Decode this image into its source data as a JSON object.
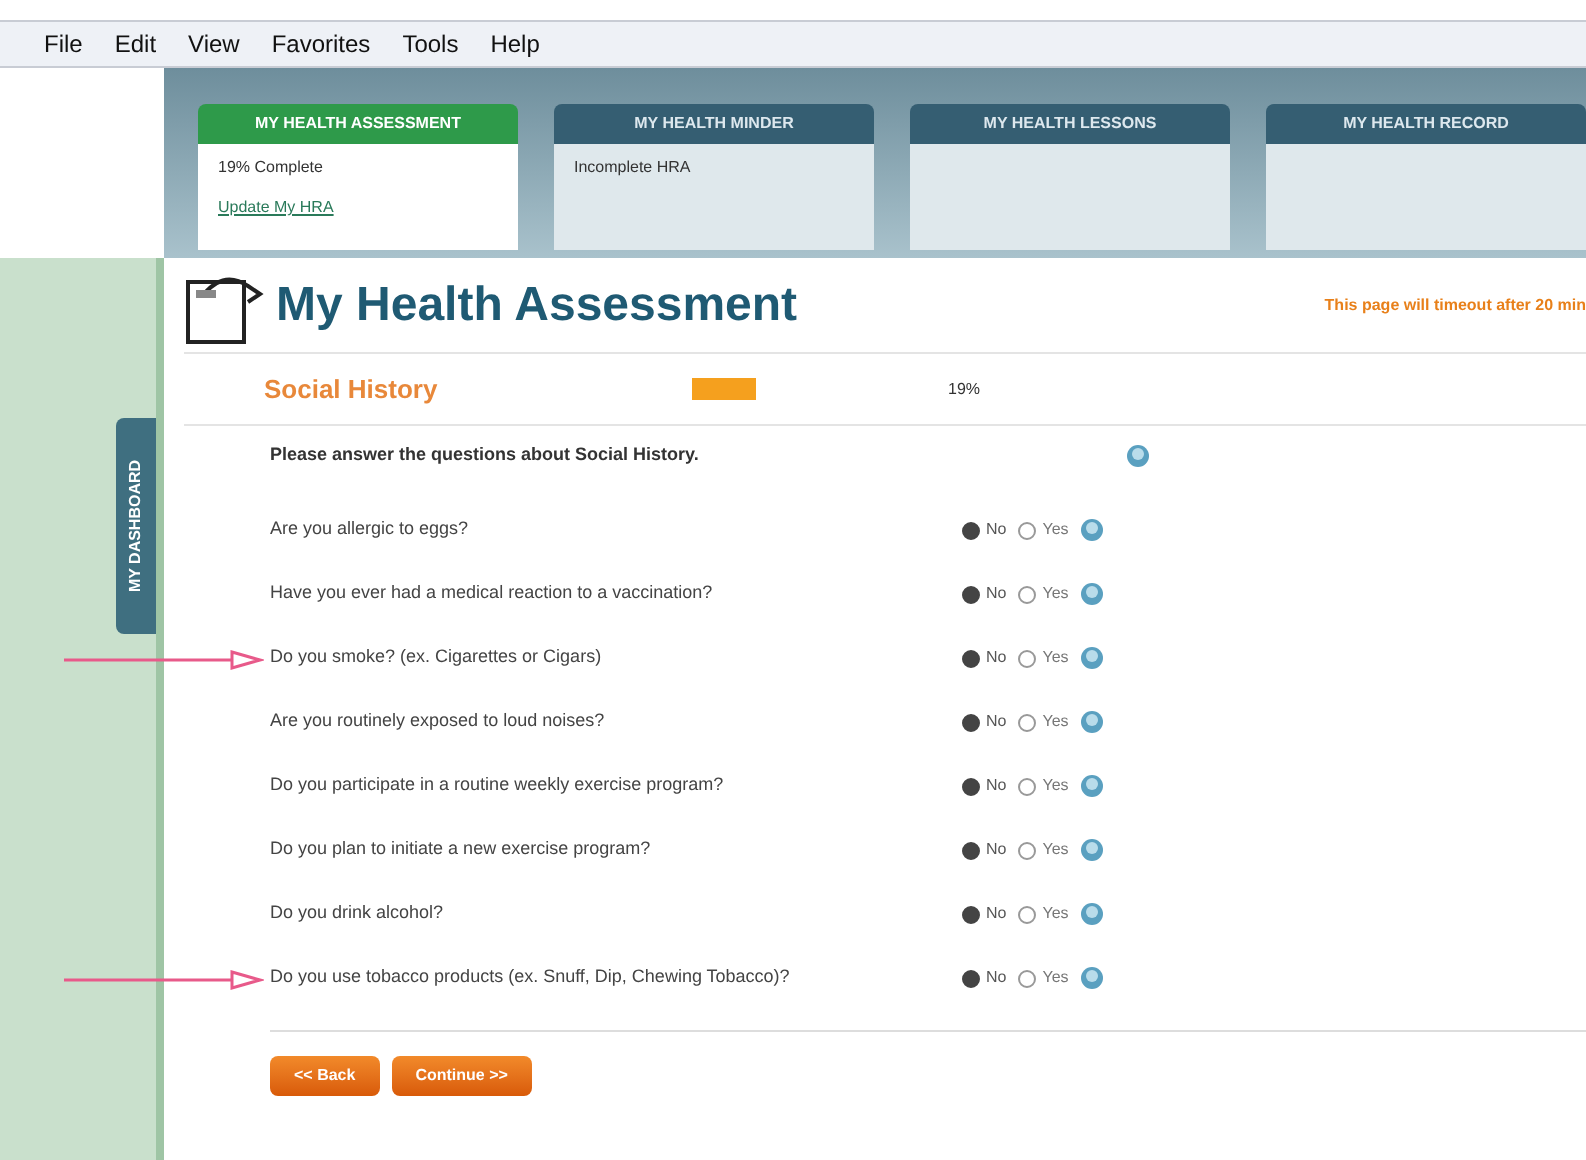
{
  "menu": [
    "File",
    "Edit",
    "View",
    "Favorites",
    "Tools",
    "Help"
  ],
  "tabs": [
    {
      "label": "MY HEALTH ASSESSMENT",
      "selected": true,
      "lines": [
        {
          "kind": "text",
          "text": "19% Complete"
        },
        {
          "kind": "link",
          "text": "Update My HRA"
        }
      ]
    },
    {
      "label": "MY HEALTH MINDER",
      "selected": false,
      "lines": [
        {
          "kind": "text",
          "text": "Incomplete HRA"
        }
      ]
    },
    {
      "label": "MY HEALTH LESSONS",
      "selected": false
    },
    {
      "label": "MY HEALTH RECORD",
      "selected": false
    }
  ],
  "sidebar_tab": "MY DASHBOARD",
  "title": "My Health Assessment",
  "timeout_notice": "This page will timeout after 20 min",
  "section": {
    "title": "Social History",
    "level": 0.19,
    "percent": "19%"
  },
  "instructions": "Please answer the questions about Social History.",
  "questions": [
    {
      "text": "Are you allergic to eggs?",
      "highlighted": false,
      "options": [
        {
          "label": "No",
          "selected": true
        },
        {
          "label": "Yes",
          "selected": false
        }
      ]
    },
    {
      "text": "Have you ever had a medical reaction to a vaccination?",
      "highlighted": false,
      "options": [
        {
          "label": "No",
          "selected": true
        },
        {
          "label": "Yes",
          "selected": false
        }
      ]
    },
    {
      "text": "Do you smoke? (ex. Cigarettes or Cigars)",
      "highlighted": true,
      "options": [
        {
          "label": "No",
          "selected": true
        },
        {
          "label": "Yes",
          "selected": false
        }
      ]
    },
    {
      "text": "Are you routinely exposed to loud noises?",
      "highlighted": false,
      "options": [
        {
          "label": "No",
          "selected": true
        },
        {
          "label": "Yes",
          "selected": false
        }
      ]
    },
    {
      "text": "Do you participate in a routine weekly exercise program?",
      "highlighted": false,
      "options": [
        {
          "label": "No",
          "selected": true
        },
        {
          "label": "Yes",
          "selected": false
        }
      ]
    },
    {
      "text": "Do you plan to initiate a new exercise program?",
      "highlighted": false,
      "options": [
        {
          "label": "No",
          "selected": true
        },
        {
          "label": "Yes",
          "selected": false
        }
      ]
    },
    {
      "text": "Do you drink alcohol?",
      "highlighted": false,
      "options": [
        {
          "label": "No",
          "selected": true
        },
        {
          "label": "Yes",
          "selected": false
        }
      ]
    },
    {
      "text": "Do you use tobacco products (ex. Snuff, Dip, Chewing Tobacco)?",
      "highlighted": true,
      "options": [
        {
          "label": "No",
          "selected": true
        },
        {
          "label": "Yes",
          "selected": false
        }
      ]
    }
  ],
  "buttons": [
    "<< Back",
    "Continue >>"
  ]
}
